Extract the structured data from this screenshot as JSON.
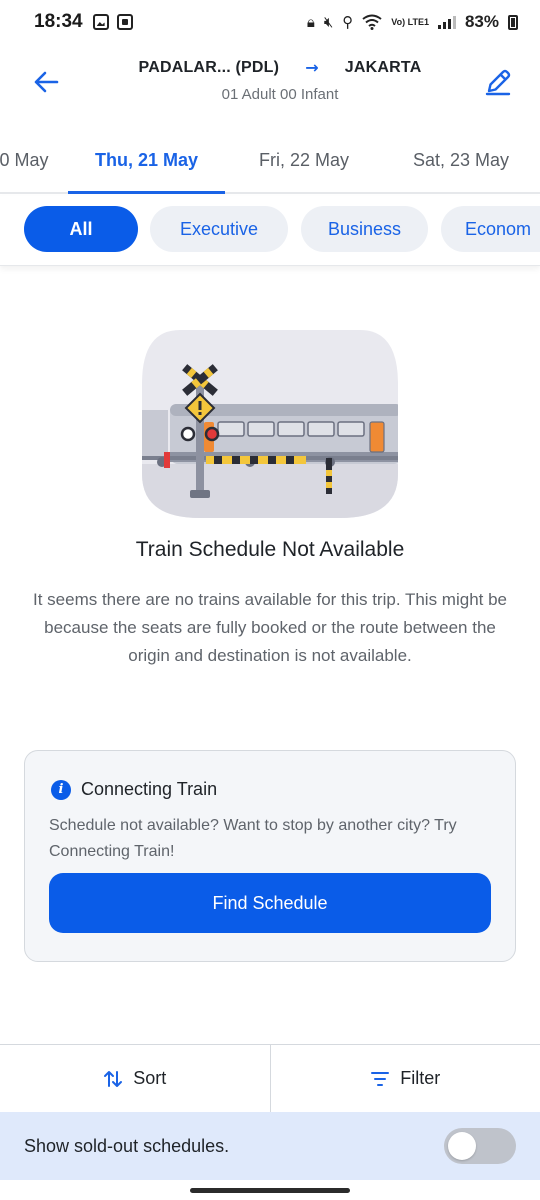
{
  "status_bar": {
    "time": "18:34",
    "network": "Vo) LTE1",
    "battery": "83%"
  },
  "header": {
    "origin": "PADALAR... (PDL)",
    "destination": "JAKARTA",
    "passengers": "01 Adult 00 Infant",
    "accent_color": "#1a63e6"
  },
  "date_tabs": [
    {
      "label": "0 May",
      "active": false
    },
    {
      "label": "Thu, 21 May",
      "active": true
    },
    {
      "label": "Fri, 22 May",
      "active": false
    },
    {
      "label": "Sat, 23 May",
      "active": false
    }
  ],
  "class_filters": [
    {
      "label": "All",
      "active": true
    },
    {
      "label": "Executive",
      "active": false
    },
    {
      "label": "Business",
      "active": false
    },
    {
      "label": "Econom",
      "active": false
    }
  ],
  "empty_state": {
    "title": "Train Schedule Not Available",
    "description": "It seems there are no trains available for this trip. This might be because the seats are fully booked or the route between the origin and destination is not available."
  },
  "connecting_card": {
    "title": "Connecting Train",
    "text": "Schedule not available? Want to stop by another city? Try Connecting Train!",
    "button_label": "Find Schedule"
  },
  "actions": {
    "sort_label": "Sort",
    "filter_label": "Filter"
  },
  "sold_out": {
    "label": "Show sold-out schedules.",
    "enabled": false
  }
}
